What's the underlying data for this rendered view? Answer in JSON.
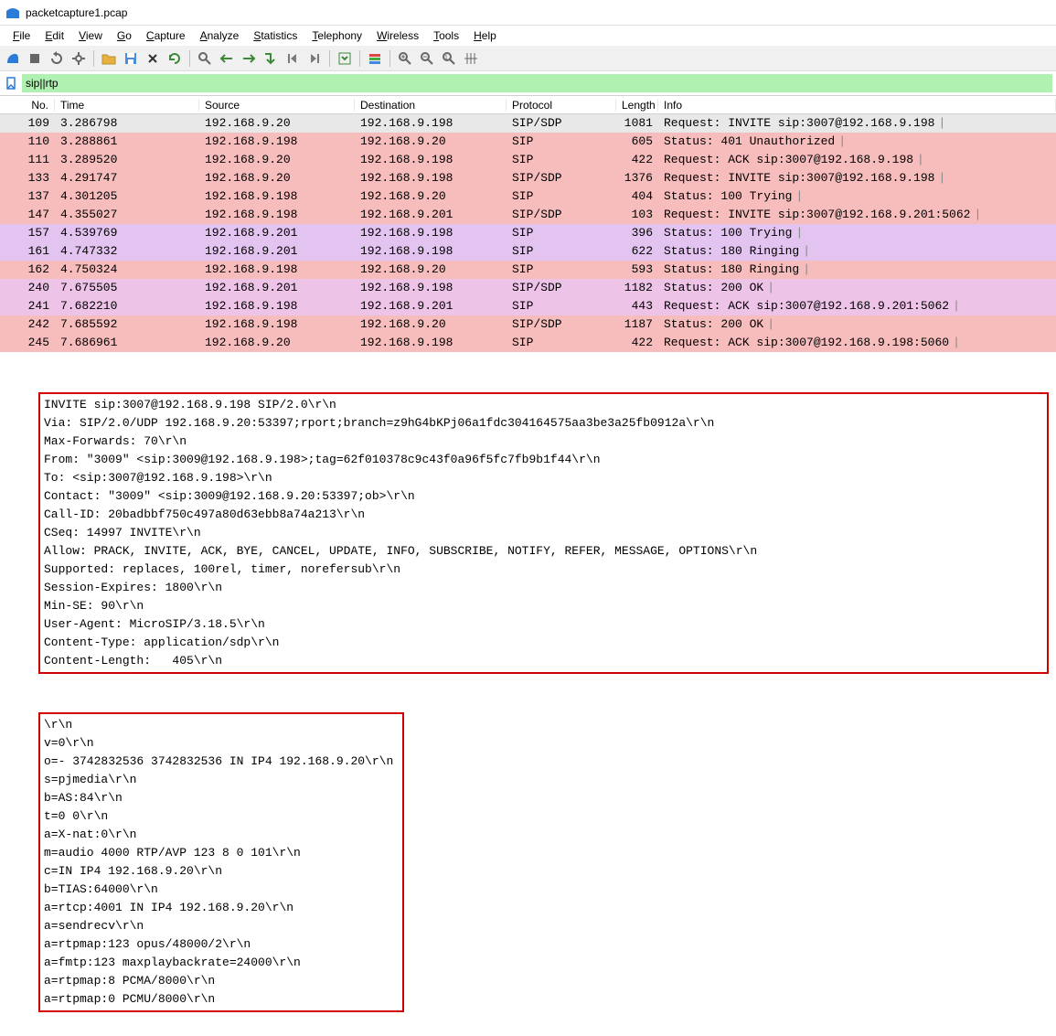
{
  "window": {
    "title": "packetcapture1.pcap"
  },
  "menus": [
    "File",
    "Edit",
    "View",
    "Go",
    "Capture",
    "Analyze",
    "Statistics",
    "Telephony",
    "Wireless",
    "Tools",
    "Help"
  ],
  "toolbar": [
    {
      "name": "start-capture-icon",
      "color": "#2b7bd9",
      "shape": "fin"
    },
    {
      "name": "stop-capture-icon",
      "color": "#666",
      "shape": "square"
    },
    {
      "name": "restart-capture-icon",
      "color": "#666",
      "shape": "restart"
    },
    {
      "name": "capture-options-icon",
      "color": "#666",
      "shape": "gear"
    },
    {
      "name": "sep"
    },
    {
      "name": "open-file-icon",
      "color": "#e8b040",
      "shape": "folder"
    },
    {
      "name": "save-file-icon",
      "color": "#4a90d9",
      "shape": "floppy"
    },
    {
      "name": "close-file-icon",
      "color": "#333",
      "shape": "x"
    },
    {
      "name": "reload-icon",
      "color": "#3a8a3a",
      "shape": "reload"
    },
    {
      "name": "sep"
    },
    {
      "name": "find-icon",
      "color": "#666",
      "shape": "magnifier"
    },
    {
      "name": "go-back-icon",
      "color": "#3a8a3a",
      "shape": "arrow-left"
    },
    {
      "name": "go-forward-icon",
      "color": "#3a8a3a",
      "shape": "arrow-right"
    },
    {
      "name": "go-to-packet-icon",
      "color": "#3a8a3a",
      "shape": "arrow-jump"
    },
    {
      "name": "first-packet-icon",
      "color": "#7a7a7a",
      "shape": "arrow-first"
    },
    {
      "name": "last-packet-icon",
      "color": "#7a7a7a",
      "shape": "arrow-last"
    },
    {
      "name": "sep"
    },
    {
      "name": "auto-scroll-icon",
      "color": "#3a8a3a",
      "shape": "autoscroll"
    },
    {
      "name": "sep"
    },
    {
      "name": "colorize-icon",
      "color": "#888",
      "shape": "colorize"
    },
    {
      "name": "sep"
    },
    {
      "name": "zoom-in-icon",
      "color": "#666",
      "shape": "zoom-in"
    },
    {
      "name": "zoom-out-icon",
      "color": "#666",
      "shape": "zoom-out"
    },
    {
      "name": "zoom-reset-icon",
      "color": "#666",
      "shape": "zoom-reset"
    },
    {
      "name": "resize-columns-icon",
      "color": "#666",
      "shape": "resize-cols"
    }
  ],
  "filter": {
    "value": "sip||rtp"
  },
  "columns": [
    "No.",
    "Time",
    "Source",
    "Destination",
    "Protocol",
    "Length",
    "Info"
  ],
  "packets": [
    {
      "no": "109",
      "time": "3.286798",
      "src": "192.168.9.20",
      "dst": "192.168.9.198",
      "proto": "SIP/SDP",
      "len": "1081",
      "info": "Request: INVITE sip:3007@192.168.9.198",
      "bg": "#e8e8e8",
      "sel": true
    },
    {
      "no": "110",
      "time": "3.288861",
      "src": "192.168.9.198",
      "dst": "192.168.9.20",
      "proto": "SIP",
      "len": "605",
      "info": "Status: 401 Unauthorized",
      "bg": "#f7bcbc"
    },
    {
      "no": "111",
      "time": "3.289520",
      "src": "192.168.9.20",
      "dst": "192.168.9.198",
      "proto": "SIP",
      "len": "422",
      "info": "Request: ACK sip:3007@192.168.9.198",
      "bg": "#f7bcbc"
    },
    {
      "no": "133",
      "time": "4.291747",
      "src": "192.168.9.20",
      "dst": "192.168.9.198",
      "proto": "SIP/SDP",
      "len": "1376",
      "info": "Request: INVITE sip:3007@192.168.9.198",
      "bg": "#f7bcbc"
    },
    {
      "no": "137",
      "time": "4.301205",
      "src": "192.168.9.198",
      "dst": "192.168.9.20",
      "proto": "SIP",
      "len": "404",
      "info": "Status: 100 Trying",
      "bg": "#f7bcbc"
    },
    {
      "no": "147",
      "time": "4.355027",
      "src": "192.168.9.198",
      "dst": "192.168.9.201",
      "proto": "SIP/SDP",
      "len": "103",
      "info": "Request: INVITE sip:3007@192.168.9.201:5062",
      "bg": "#f7bcbc"
    },
    {
      "no": "157",
      "time": "4.539769",
      "src": "192.168.9.201",
      "dst": "192.168.9.198",
      "proto": "SIP",
      "len": "396",
      "info": "Status: 100 Trying",
      "bg": "#e3c4f0"
    },
    {
      "no": "161",
      "time": "4.747332",
      "src": "192.168.9.201",
      "dst": "192.168.9.198",
      "proto": "SIP",
      "len": "622",
      "info": "Status: 180 Ringing",
      "bg": "#e3c4f0"
    },
    {
      "no": "162",
      "time": "4.750324",
      "src": "192.168.9.198",
      "dst": "192.168.9.20",
      "proto": "SIP",
      "len": "593",
      "info": "Status: 180 Ringing",
      "bg": "#f7bcbc"
    },
    {
      "no": "240",
      "time": "7.675505",
      "src": "192.168.9.201",
      "dst": "192.168.9.198",
      "proto": "SIP/SDP",
      "len": "1182",
      "info": "Status: 200 OK",
      "bg": "#eec3e8"
    },
    {
      "no": "241",
      "time": "7.682210",
      "src": "192.168.9.198",
      "dst": "192.168.9.201",
      "proto": "SIP",
      "len": "443",
      "info": "Request: ACK sip:3007@192.168.9.201:5062",
      "bg": "#eec3e8"
    },
    {
      "no": "242",
      "time": "7.685592",
      "src": "192.168.9.198",
      "dst": "192.168.9.20",
      "proto": "SIP/SDP",
      "len": "1187",
      "info": "Status: 200 OK",
      "bg": "#f7bcbc"
    },
    {
      "no": "245",
      "time": "7.686961",
      "src": "192.168.9.20",
      "dst": "192.168.9.198",
      "proto": "SIP",
      "len": "422",
      "info": "Request: ACK sip:3007@192.168.9.198:5060",
      "bg": "#f7bcbc"
    }
  ],
  "sip_headers": [
    "INVITE sip:3007@192.168.9.198 SIP/2.0\\r\\n",
    "Via: SIP/2.0/UDP 192.168.9.20:53397;rport;branch=z9hG4bKPj06a1fdc304164575aa3be3a25fb0912a\\r\\n",
    "Max-Forwards: 70\\r\\n",
    "From: \"3009\" <sip:3009@192.168.9.198>;tag=62f010378c9c43f0a96f5fc7fb9b1f44\\r\\n",
    "To: <sip:3007@192.168.9.198>\\r\\n",
    "Contact: \"3009\" <sip:3009@192.168.9.20:53397;ob>\\r\\n",
    "Call-ID: 20badbbf750c497a80d63ebb8a74a213\\r\\n",
    "CSeq: 14997 INVITE\\r\\n",
    "Allow: PRACK, INVITE, ACK, BYE, CANCEL, UPDATE, INFO, SUBSCRIBE, NOTIFY, REFER, MESSAGE, OPTIONS\\r\\n",
    "Supported: replaces, 100rel, timer, norefersub\\r\\n",
    "Session-Expires: 1800\\r\\n",
    "Min-SE: 90\\r\\n",
    "User-Agent: MicroSIP/3.18.5\\r\\n",
    "Content-Type: application/sdp\\r\\n",
    "Content-Length:   405\\r\\n"
  ],
  "sdp_body": [
    "\\r\\n",
    "v=0\\r\\n",
    "o=- 3742832536 3742832536 IN IP4 192.168.9.20\\r\\n",
    "s=pjmedia\\r\\n",
    "b=AS:84\\r\\n",
    "t=0 0\\r\\n",
    "a=X-nat:0\\r\\n",
    "m=audio 4000 RTP/AVP 123 8 0 101\\r\\n",
    "c=IN IP4 192.168.9.20\\r\\n",
    "b=TIAS:64000\\r\\n",
    "a=rtcp:4001 IN IP4 192.168.9.20\\r\\n",
    "a=sendrecv\\r\\n",
    "a=rtpmap:123 opus/48000/2\\r\\n",
    "a=fmtp:123 maxplaybackrate=24000\\r\\n",
    "a=rtpmap:8 PCMA/8000\\r\\n",
    "a=rtpmap:0 PCMU/8000\\r\\n"
  ]
}
